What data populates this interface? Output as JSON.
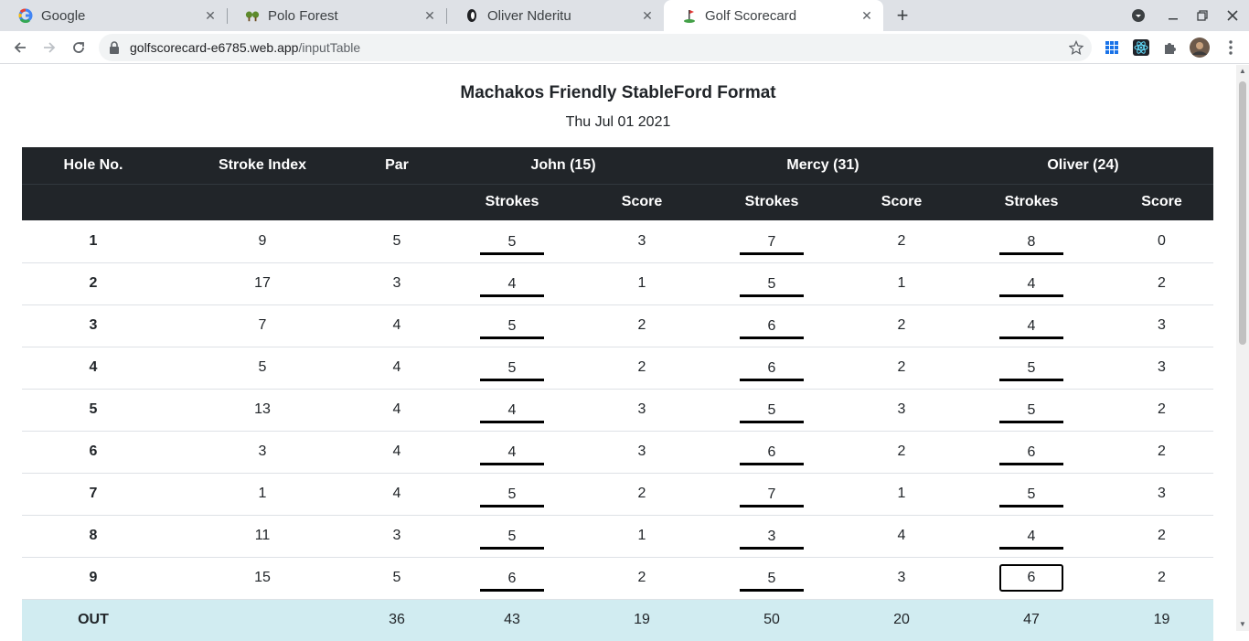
{
  "browser": {
    "tabs": [
      {
        "title": "Google",
        "icon": "google-icon"
      },
      {
        "title": "Polo Forest",
        "icon": "polo-forest-icon"
      },
      {
        "title": "Oliver Nderitu",
        "icon": "github-icon"
      },
      {
        "title": "Golf Scorecard",
        "icon": "golf-icon"
      }
    ],
    "url_host": "golfscorecard-e6785.web.app",
    "url_path": "/inputTable"
  },
  "page": {
    "title": "Machakos Friendly StableFord Format",
    "date": "Thu Jul 01 2021"
  },
  "table": {
    "headers": {
      "hole": "Hole No.",
      "stroke_index": "Stroke Index",
      "par": "Par",
      "players": [
        "John (15)",
        "Mercy (31)",
        "Oliver (24)"
      ],
      "strokes": "Strokes",
      "score": "Score"
    },
    "rows": [
      {
        "hole": "1",
        "si": "9",
        "par": "5",
        "p": [
          [
            "5",
            "3"
          ],
          [
            "7",
            "2"
          ],
          [
            "8",
            "0"
          ]
        ]
      },
      {
        "hole": "2",
        "si": "17",
        "par": "3",
        "p": [
          [
            "4",
            "1"
          ],
          [
            "5",
            "1"
          ],
          [
            "4",
            "2"
          ]
        ]
      },
      {
        "hole": "3",
        "si": "7",
        "par": "4",
        "p": [
          [
            "5",
            "2"
          ],
          [
            "6",
            "2"
          ],
          [
            "4",
            "3"
          ]
        ]
      },
      {
        "hole": "4",
        "si": "5",
        "par": "4",
        "p": [
          [
            "5",
            "2"
          ],
          [
            "6",
            "2"
          ],
          [
            "5",
            "3"
          ]
        ]
      },
      {
        "hole": "5",
        "si": "13",
        "par": "4",
        "p": [
          [
            "4",
            "3"
          ],
          [
            "5",
            "3"
          ],
          [
            "5",
            "2"
          ]
        ]
      },
      {
        "hole": "6",
        "si": "3",
        "par": "4",
        "p": [
          [
            "4",
            "3"
          ],
          [
            "6",
            "2"
          ],
          [
            "6",
            "2"
          ]
        ]
      },
      {
        "hole": "7",
        "si": "1",
        "par": "4",
        "p": [
          [
            "5",
            "2"
          ],
          [
            "7",
            "1"
          ],
          [
            "5",
            "3"
          ]
        ]
      },
      {
        "hole": "8",
        "si": "11",
        "par": "3",
        "p": [
          [
            "5",
            "1"
          ],
          [
            "3",
            "4"
          ],
          [
            "4",
            "2"
          ]
        ]
      },
      {
        "hole": "9",
        "si": "15",
        "par": "5",
        "p": [
          [
            "6",
            "2"
          ],
          [
            "5",
            "3"
          ],
          [
            "6",
            "2"
          ]
        ]
      }
    ],
    "out": {
      "label": "OUT",
      "par": "36",
      "p": [
        [
          "43",
          "19"
        ],
        [
          "50",
          "20"
        ],
        [
          "47",
          "19"
        ]
      ]
    }
  }
}
